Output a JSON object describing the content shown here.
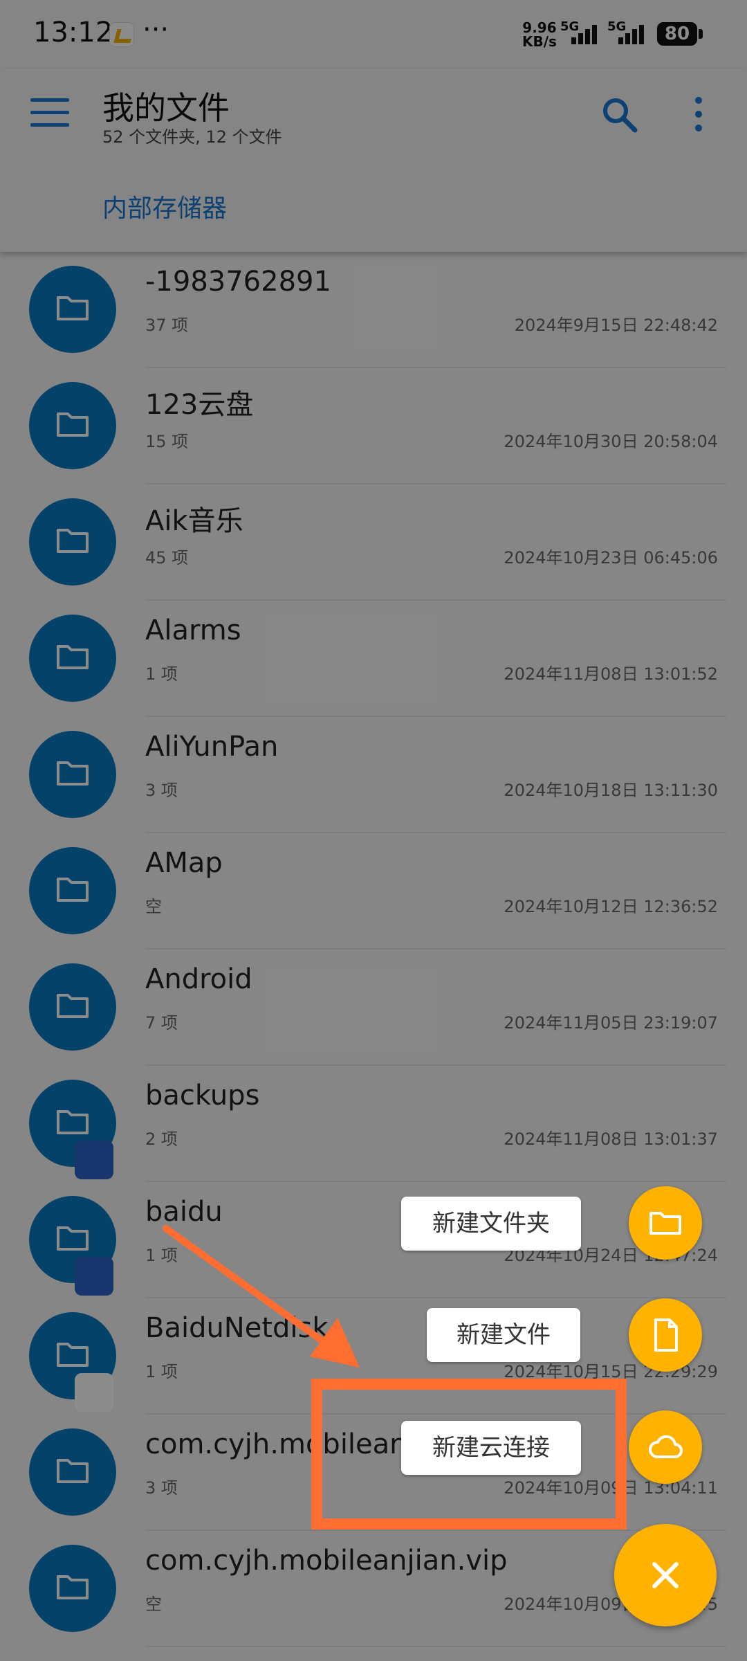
{
  "status_bar": {
    "time": "13:12",
    "dots": "···",
    "speed_value": "9.96",
    "speed_unit": "KB/s",
    "signal1": "5G",
    "signal2": "5G",
    "battery": "80"
  },
  "header": {
    "title": "我的文件",
    "subtitle": "52 个文件夹, 12 个文件",
    "breadcrumb": "内部存储器"
  },
  "colors": {
    "accent": "#1976d2",
    "folder": "#0a78c2",
    "fab": "#ffb300",
    "annotation": "#ff6e30"
  },
  "files": [
    {
      "name": "-1983762891",
      "count": "37 项",
      "date": "2024年9月15日 22:48:42"
    },
    {
      "name": "123云盘",
      "count": "15 项",
      "date": "2024年10月30日 20:58:04"
    },
    {
      "name": "Aik音乐",
      "count": "45 项",
      "date": "2024年10月23日 06:45:06"
    },
    {
      "name": "Alarms",
      "count": "1 项",
      "date": "2024年11月08日 13:01:52"
    },
    {
      "name": "AliYunPan",
      "count": "3 项",
      "date": "2024年10月18日 13:11:30"
    },
    {
      "name": "AMap",
      "count": "空",
      "date": "2024年10月12日 12:36:52"
    },
    {
      "name": "Android",
      "count": "7 项",
      "date": "2024年11月05日 23:19:07"
    },
    {
      "name": "backups",
      "count": "2 项",
      "date": "2024年11月08日 13:01:37"
    },
    {
      "name": "baidu",
      "count": "1 项",
      "date": "2024年10月24日 12:47:24"
    },
    {
      "name": "BaiduNetdisk",
      "count": "1 项",
      "date": "2024年10月15日 22:29:29"
    },
    {
      "name": "com.cyjh.mobileanjian",
      "count": "3 项",
      "date": "2024年10月09日 13:04:11"
    },
    {
      "name": "com.cyjh.mobileanjian.vip",
      "count": "空",
      "date": "2024年10月09日 13:04:45"
    }
  ],
  "fab_menu": {
    "new_folder": "新建文件夹",
    "new_file": "新建文件",
    "new_cloud": "新建云连接",
    "icons": [
      "folder-icon",
      "file-icon",
      "cloud-icon",
      "close-icon"
    ]
  }
}
